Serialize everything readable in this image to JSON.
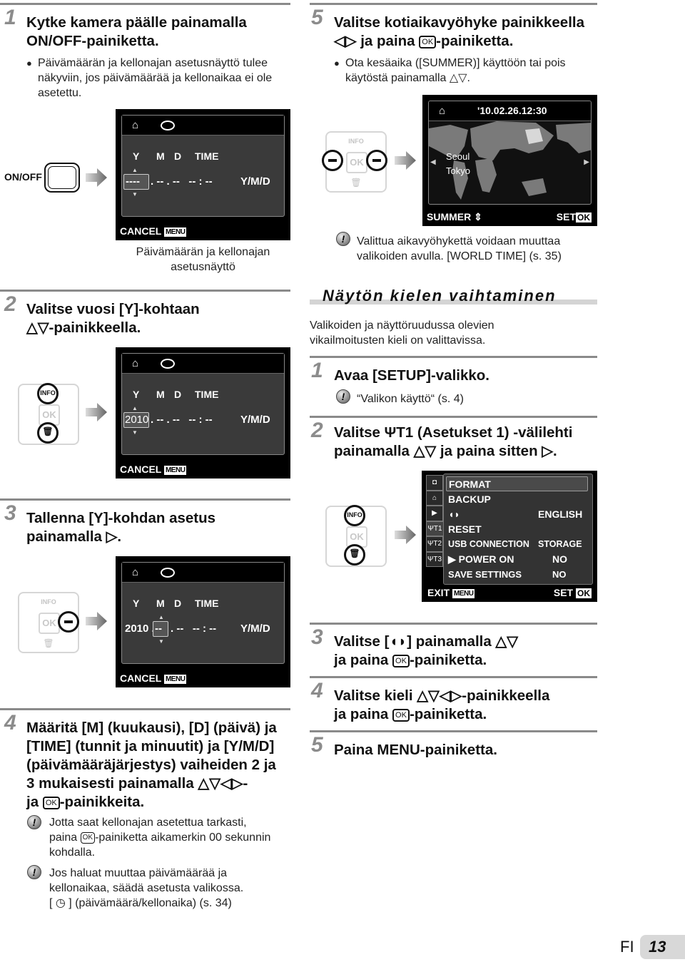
{
  "left": {
    "step1": {
      "num": "1",
      "title_line1": "Kytke kamera päälle painamalla",
      "title_line2": "ON/OFF-painiketta.",
      "bullet": "Päivämäärän ja kellonajan asetusnäyttö tulee näkyviin, jos päivämäärää ja kellonaikaa ei ole asetettu.",
      "button_label": "ON/OFF",
      "screen": {
        "cols": [
          "Y",
          "M",
          "D",
          "TIME"
        ],
        "year": "----",
        "rest": ". -- . --   -- : --",
        "order": "Y/M/D",
        "cancel": "CANCEL",
        "menu_tag": "MENU"
      },
      "caption_line1": "Päivämäärän ja kellonajan",
      "caption_line2": "asetusnäyttö"
    },
    "step2": {
      "num": "2",
      "title_line1": "Valitse vuosi [Y]-kohtaan",
      "title_line2": "△▽-painikkeella.",
      "pad": {
        "info": "INFO",
        "ok": "OK"
      },
      "screen": {
        "cols": [
          "Y",
          "M",
          "D",
          "TIME"
        ],
        "year": "2010",
        "rest": ". -- . --   -- : --",
        "order": "Y/M/D",
        "cancel": "CANCEL",
        "menu_tag": "MENU"
      }
    },
    "step3": {
      "num": "3",
      "title_line1": "Tallenna [Y]-kohdan asetus",
      "title_line2": "painamalla ▷.",
      "pad": {
        "info": "INFO",
        "ok": "OK"
      },
      "screen": {
        "cols": [
          "Y",
          "M",
          "D",
          "TIME"
        ],
        "year": "2010 .",
        "month": "--",
        "rest": ". --   -- : --",
        "order": "Y/M/D",
        "cancel": "CANCEL",
        "menu_tag": "MENU"
      }
    },
    "step4": {
      "num": "4",
      "title_lines": [
        "Määritä [M] (kuukausi), [D] (päivä) ja",
        "[TIME] (tunnit ja minuutit) ja [Y/M/D]",
        "(päivämääräjärjestys) vaiheiden 2 ja",
        "3 mukaisesti painamalla △▽◁▷-",
        "ja"
      ],
      "title_tail": "-painikkeita.",
      "ok_label": "OK",
      "note1": {
        "line1": "Jotta saat kellonajan asetettua tarkasti,",
        "line2_pre": "paina",
        "line2_post": "-painiketta aikamerkin 00 sekunnin",
        "line3": "kohdalla."
      },
      "note2": {
        "line1": "Jos haluat muuttaa päivämäärää ja",
        "line2": "kellonaikaa, säädä asetusta valikossa.",
        "line3": "[ ◷ ] (päivämäärä/kellonaika) (s. 34)"
      }
    }
  },
  "right": {
    "step5": {
      "num": "5",
      "title_line1": "Valitse kotiaikavyöhyke painikkeella",
      "title_line2_pre": "◁▷ ja paina",
      "title_line2_post": "-painiketta.",
      "ok_label": "OK",
      "bullet_line1": "Ota kesäaika ([SUMMER)] käyttöön tai pois",
      "bullet_line2": "käytöstä painamalla △▽.",
      "pad": {
        "info": "INFO",
        "ok": "OK"
      },
      "screen": {
        "datetime": "'10.02.26.12:30",
        "city1": "Seoul",
        "city2": "Tokyo",
        "summer": "SUMMER",
        "set": "SET",
        "ok_tag": "OK"
      },
      "note_line1": "Valittua aikavyöhykettä voidaan muuttaa",
      "note_line2": "valikoiden avulla. [WORLD TIME] (s. 35)"
    },
    "section": {
      "title": "Näytön kielen vaihtaminen",
      "intro_line1": "Valikoiden ja näyttöruudussa olevien",
      "intro_line2": "vikailmoitusten kieli on valittavissa."
    },
    "lang_step1": {
      "num": "1",
      "title": "Avaa [SETUP]-valikko.",
      "note": "“Valikon käyttö“ (s. 4)"
    },
    "lang_step2": {
      "num": "2",
      "title_line1": "Valitse ΨΤ1 (Asetukset 1) -välilehti",
      "title_line2": "painamalla △▽ ja paina sitten ▷.",
      "pad": {
        "info": "INFO",
        "ok": "OK"
      },
      "menu": {
        "tabs": [
          "camera",
          "movie",
          "playback",
          "setup1",
          "setup2",
          "setup3"
        ],
        "tab_labels": [
          "◘",
          "⌂",
          "▶",
          "ΨΤ1",
          "ΨΤ2",
          "ΨΤ3"
        ],
        "rows": [
          {
            "label": "FORMAT",
            "value": ""
          },
          {
            "label": "BACKUP",
            "value": ""
          },
          {
            "label": "◖◗",
            "value": "ENGLISH"
          },
          {
            "label": "RESET",
            "value": ""
          },
          {
            "label": "USB CONNECTION",
            "value": "STORAGE"
          },
          {
            "label": "▶ POWER ON",
            "value": "NO"
          },
          {
            "label": "SAVE SETTINGS",
            "value": "NO"
          }
        ],
        "exit": "EXIT",
        "menu_tag": "MENU",
        "set": "SET",
        "ok_tag": "OK"
      }
    },
    "lang_step3": {
      "num": "3",
      "title_line1": "Valitse [◖◗] painamalla △▽",
      "title_line2_pre": "ja paina",
      "title_line2_post": "-painiketta.",
      "ok_label": "OK"
    },
    "lang_step4": {
      "num": "4",
      "title_line1": "Valitse kieli △▽◁▷-painikkeella",
      "title_line2_pre": "ja paina",
      "title_line2_post": "-painiketta.",
      "ok_label": "OK"
    },
    "lang_step5": {
      "num": "5",
      "title": "Paina MENU-painiketta."
    }
  },
  "footer": {
    "lang": "FI",
    "page": "13"
  }
}
